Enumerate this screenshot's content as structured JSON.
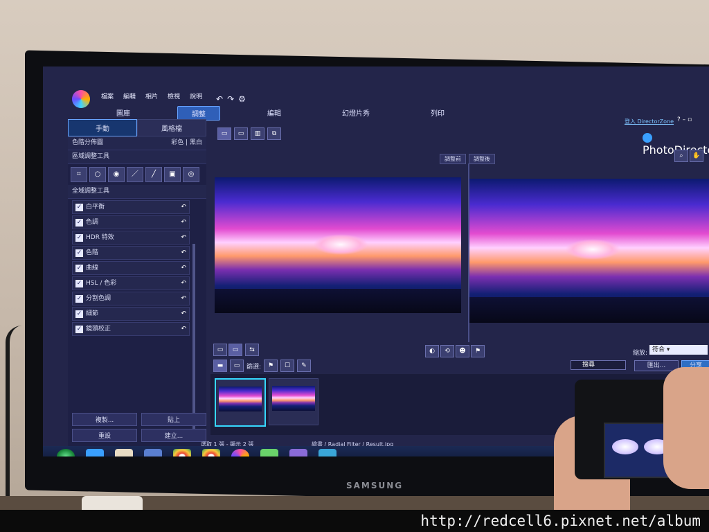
{
  "app": {
    "menu": [
      "檔案",
      "編輯",
      "相片",
      "檢視",
      "說明"
    ],
    "modes": [
      {
        "label": "圖庫",
        "active": false
      },
      {
        "label": "調整",
        "active": true
      },
      {
        "label": "編輯",
        "active": false
      },
      {
        "label": "幻燈片秀",
        "active": false
      },
      {
        "label": "列印",
        "active": false
      }
    ],
    "login": "登入 DirectorZone",
    "help": "?",
    "brand": "PhotoDirecto"
  },
  "panel": {
    "tabs": [
      {
        "label": "手動",
        "active": true
      },
      {
        "label": "風格檔",
        "active": false
      }
    ],
    "histogram_label": "色階分佈圖",
    "color_mode": "彩色",
    "bw_mode": "黑白",
    "regional_tools_label": "區域調整工具",
    "global_tools_label": "全域調整工具",
    "adjustments": [
      "白平衡",
      "色調",
      "HDR 特效",
      "色階",
      "曲線",
      "HSL / 色彩",
      "分割色調",
      "細節",
      "鏡頭校正"
    ],
    "buttons": [
      "複製...",
      "貼上",
      "重設",
      "建立..."
    ]
  },
  "viewer": {
    "before_label": "調整前",
    "after_label": "調整後",
    "zoom_label": "縮放:",
    "zoom_value": "符合"
  },
  "filmstrip": {
    "filter_label": "篩選:",
    "search_placeholder": "搜尋",
    "export_label": "匯出...",
    "share_label": "分享"
  },
  "status": {
    "selection": "選取 1 張 - 顯示 2 張",
    "path": "繪畫 / Radial Filter / Result.jpg"
  },
  "tv_brand": "SAMSUNG",
  "watermark": "http://redcell6.pixnet.net/album",
  "colors": {
    "accent": "#2f5fb8",
    "selection": "#36d9ff",
    "panel": "#1e2045"
  }
}
